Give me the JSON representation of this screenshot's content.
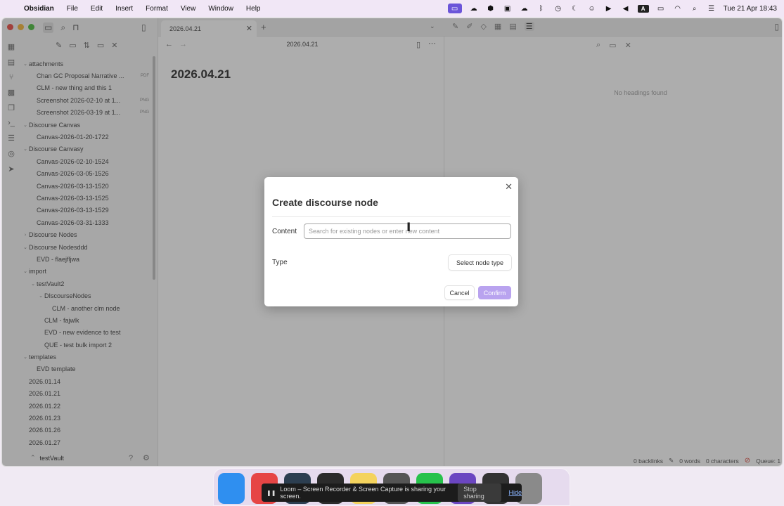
{
  "menubar": {
    "app_name": "Obsidian",
    "menus": [
      "File",
      "Edit",
      "Insert",
      "Format",
      "View",
      "Window",
      "Help"
    ],
    "datetime": "Tue 21 Apr  18:43",
    "keyboard_label": "A"
  },
  "sidebar": {
    "tree": [
      {
        "label": "attachments",
        "level": 0,
        "expanded": true,
        "type": "folder"
      },
      {
        "label": "Chan GC Proposal Narrative ...",
        "level": 1,
        "badge": "PDF",
        "type": "file"
      },
      {
        "label": "CLM - new thing and this 1",
        "level": 1,
        "type": "file"
      },
      {
        "label": "Screenshot 2026-02-10 at 1...",
        "level": 1,
        "badge": "PNG",
        "type": "file"
      },
      {
        "label": "Screenshot 2026-03-19 at 1...",
        "level": 1,
        "badge": "PNG",
        "type": "file"
      },
      {
        "label": "Discourse Canvas",
        "level": 0,
        "expanded": true,
        "type": "folder"
      },
      {
        "label": "Canvas-2026-01-20-1722",
        "level": 1,
        "type": "file"
      },
      {
        "label": "Discourse Canvasy",
        "level": 0,
        "expanded": true,
        "type": "folder"
      },
      {
        "label": "Canvas-2026-02-10-1524",
        "level": 1,
        "type": "file"
      },
      {
        "label": "Canvas-2026-03-05-1526",
        "level": 1,
        "type": "file"
      },
      {
        "label": "Canvas-2026-03-13-1520",
        "level": 1,
        "type": "file"
      },
      {
        "label": "Canvas-2026-03-13-1525",
        "level": 1,
        "type": "file"
      },
      {
        "label": "Canvas-2026-03-13-1529",
        "level": 1,
        "type": "file"
      },
      {
        "label": "Canvas-2026-03-31-1333",
        "level": 1,
        "type": "file"
      },
      {
        "label": "Discourse Nodes",
        "level": 0,
        "expanded": false,
        "type": "folder"
      },
      {
        "label": "Discourse Nodesddd",
        "level": 0,
        "expanded": true,
        "type": "folder"
      },
      {
        "label": "EVD - flaejfljwa",
        "level": 1,
        "type": "file"
      },
      {
        "label": "import",
        "level": 0,
        "expanded": true,
        "type": "folder"
      },
      {
        "label": "testVault2",
        "level": 1,
        "expanded": true,
        "type": "folder"
      },
      {
        "label": "DIscourseNodes",
        "level": 2,
        "expanded": true,
        "type": "folder"
      },
      {
        "label": "CLM - another clm node",
        "level": 3,
        "type": "file"
      },
      {
        "label": "CLM - fajwlk",
        "level": 2,
        "type": "file"
      },
      {
        "label": "EVD - new evidence to test",
        "level": 2,
        "type": "file"
      },
      {
        "label": "QUE - test bulk import 2",
        "level": 2,
        "type": "file"
      },
      {
        "label": "templates",
        "level": 0,
        "expanded": true,
        "type": "folder"
      },
      {
        "label": "EVD template",
        "level": 1,
        "type": "file"
      },
      {
        "label": "2026.01.14",
        "level": 0,
        "type": "file"
      },
      {
        "label": "2026.01.21",
        "level": 0,
        "type": "file"
      },
      {
        "label": "2026.01.22",
        "level": 0,
        "type": "file"
      },
      {
        "label": "2026.01.23",
        "level": 0,
        "type": "file"
      },
      {
        "label": "2026.01.26",
        "level": 0,
        "type": "file"
      },
      {
        "label": "2026.01.27",
        "level": 0,
        "type": "file"
      }
    ],
    "vault_name": "testVault"
  },
  "tab": {
    "label": "2026.04.21"
  },
  "editor": {
    "header_title": "2026.04.21",
    "note_title": "2026.04.21"
  },
  "outline": {
    "empty_text": "No headings found"
  },
  "statusbar": {
    "backlinks": "0 backlinks",
    "words": "0 words",
    "characters": "0 characters",
    "queue": "Queue: 1"
  },
  "modal": {
    "title": "Create discourse node",
    "content_label": "Content",
    "content_placeholder": "Search for existing nodes or enter new content",
    "content_value": "",
    "type_label": "Type",
    "type_select": "Select node type",
    "cancel_label": "Cancel",
    "confirm_label": "Confirm"
  },
  "sharing": {
    "message": "Loom – Screen Recorder & Screen Capture is sharing your screen.",
    "stop_label": "Stop sharing",
    "hide_label": "Hide"
  },
  "colors": {
    "accent": "#b9a3ef",
    "menubar_highlight": "#6b55d9",
    "sync_icon": "#e0594e",
    "dock_app_colors": [
      "#2f8ff0",
      "#e64545",
      "#2c3e50",
      "#2b2b2b",
      "#f4d35e",
      "#555555",
      "#27c24c",
      "#6b46c1",
      "#333333",
      "#8a8a8a"
    ]
  }
}
